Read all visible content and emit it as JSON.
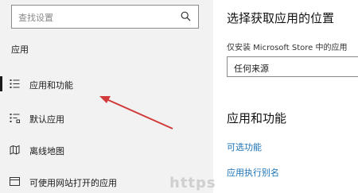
{
  "search": {
    "placeholder": "查找设置"
  },
  "sidebar": {
    "section_title": "应用",
    "items": [
      {
        "label": "应用和功能",
        "icon": "apps-list-icon",
        "active": true
      },
      {
        "label": "默认应用",
        "icon": "default-apps-icon",
        "active": false
      },
      {
        "label": "离线地图",
        "icon": "offline-map-icon",
        "active": false
      },
      {
        "label": "可使用网站打开的应用",
        "icon": "website-apps-icon",
        "active": false
      }
    ]
  },
  "main": {
    "heading_location": "选择获取应用的位置",
    "source_label": "仅安装 Microsoft Store 中的应用",
    "source_select_value": "任何来源",
    "heading_apps": "应用和功能",
    "link_optional": "可选功能",
    "link_alias": "应用执行别名"
  },
  "watermark": {
    "text": "https"
  },
  "colors": {
    "accent_link": "#1b73b8",
    "annotation_arrow": "#d23b3b",
    "sidebar_bg": "#f2f2f2"
  }
}
